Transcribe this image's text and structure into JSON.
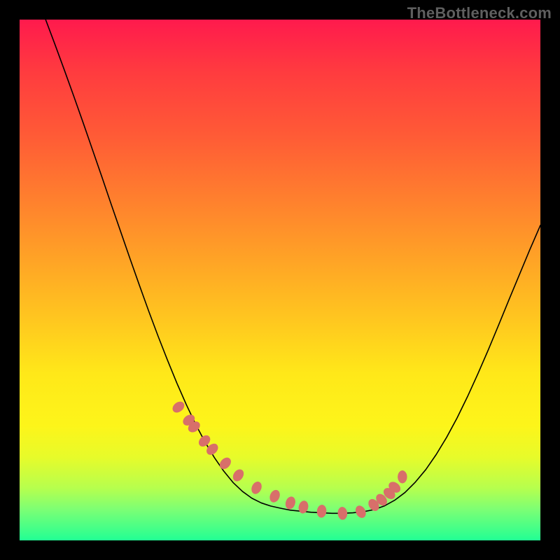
{
  "watermark": "TheBottleneck.com",
  "colors": {
    "page_background": "#000000",
    "watermark_text": "#5f5f5f",
    "curve_stroke": "#000000",
    "marker_fill": "#d86f6a",
    "gradient_stops": [
      "#ff1a4d",
      "#ff3b3f",
      "#ff5a36",
      "#ff7e2e",
      "#ffa326",
      "#ffc81f",
      "#ffe819",
      "#fdf51a",
      "#e7fb2a",
      "#b6ff4e",
      "#7dff74",
      "#22ff94"
    ]
  },
  "chart_data": {
    "type": "line",
    "title": "",
    "xlabel": "",
    "ylabel": "",
    "xlim": [
      0,
      1
    ],
    "ylim": [
      0,
      1
    ],
    "grid": false,
    "legend": false,
    "series": [
      {
        "name": "bottleneck-curve",
        "x": [
          0.05,
          0.068,
          0.086,
          0.104,
          0.122,
          0.14,
          0.158,
          0.176,
          0.194,
          0.212,
          0.23,
          0.248,
          0.266,
          0.284,
          0.302,
          0.32,
          0.338,
          0.356,
          0.374,
          0.392,
          0.41,
          0.428,
          0.446,
          0.464,
          0.482,
          0.5,
          0.52,
          0.54,
          0.56,
          0.58,
          0.6,
          0.62,
          0.64,
          0.66,
          0.68,
          0.7,
          0.72,
          0.74,
          0.76,
          0.78,
          0.8,
          0.82,
          0.84,
          0.86,
          0.88,
          0.9,
          0.92,
          0.94,
          0.96,
          0.98,
          1.0
        ],
        "y": [
          1.0,
          0.952,
          0.903,
          0.853,
          0.802,
          0.75,
          0.698,
          0.645,
          0.593,
          0.541,
          0.49,
          0.44,
          0.392,
          0.346,
          0.302,
          0.261,
          0.223,
          0.189,
          0.159,
          0.133,
          0.111,
          0.094,
          0.081,
          0.072,
          0.066,
          0.062,
          0.058,
          0.056,
          0.054,
          0.053,
          0.052,
          0.052,
          0.053,
          0.055,
          0.059,
          0.066,
          0.077,
          0.092,
          0.112,
          0.136,
          0.165,
          0.198,
          0.235,
          0.276,
          0.32,
          0.366,
          0.414,
          0.463,
          0.511,
          0.559,
          0.605
        ]
      }
    ],
    "markers": {
      "name": "highlight-points",
      "x": [
        0.305,
        0.325,
        0.335,
        0.355,
        0.37,
        0.395,
        0.42,
        0.455,
        0.49,
        0.52,
        0.545,
        0.58,
        0.62,
        0.655,
        0.68,
        0.695,
        0.71,
        0.72,
        0.735
      ],
      "y": [
        0.256,
        0.231,
        0.218,
        0.191,
        0.175,
        0.148,
        0.125,
        0.101,
        0.085,
        0.072,
        0.064,
        0.056,
        0.052,
        0.055,
        0.068,
        0.078,
        0.09,
        0.102,
        0.122
      ]
    }
  }
}
